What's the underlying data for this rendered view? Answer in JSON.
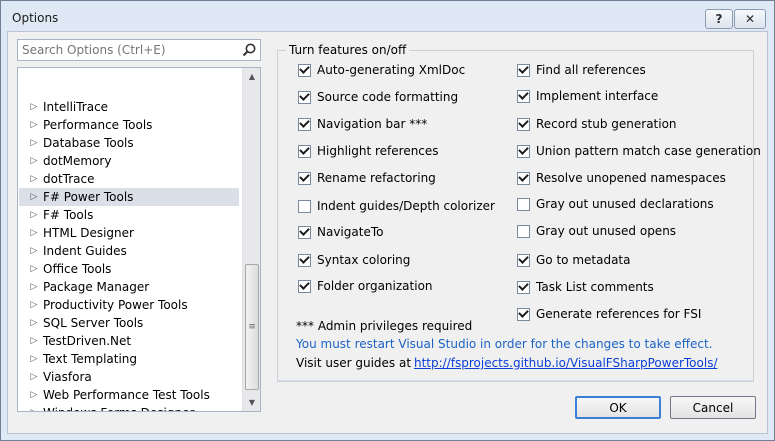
{
  "window": {
    "title": "Options",
    "help_label": "?",
    "close_label": "✕"
  },
  "search": {
    "placeholder": "Search Options (Ctrl+E)",
    "value": ""
  },
  "tree": {
    "items": [
      {
        "label": "IntelliTrace"
      },
      {
        "label": "Performance Tools"
      },
      {
        "label": "Database Tools"
      },
      {
        "label": "dotMemory"
      },
      {
        "label": "dotTrace"
      },
      {
        "label": "F# Power Tools",
        "selected": true
      },
      {
        "label": "F# Tools"
      },
      {
        "label": "HTML Designer"
      },
      {
        "label": "Indent Guides"
      },
      {
        "label": "Office Tools"
      },
      {
        "label": "Package Manager"
      },
      {
        "label": "Productivity Power Tools"
      },
      {
        "label": "SQL Server Tools"
      },
      {
        "label": "TestDriven.Net"
      },
      {
        "label": "Text Templating"
      },
      {
        "label": "Viasfora"
      },
      {
        "label": "Web Performance Test Tools"
      },
      {
        "label": "Windows Forms Designer"
      }
    ]
  },
  "features": {
    "group_label": "Turn features on/off",
    "left": [
      {
        "label": "Auto-generating XmlDoc",
        "checked": true
      },
      {
        "label": "Source code formatting",
        "checked": true
      },
      {
        "label": "Navigation bar ***",
        "checked": true
      },
      {
        "label": "Highlight references",
        "checked": true
      },
      {
        "label": "Rename refactoring",
        "checked": true
      },
      {
        "label": "Indent guides/Depth colorizer",
        "checked": false
      },
      {
        "label": "NavigateTo",
        "checked": true
      },
      {
        "label": "Syntax coloring",
        "checked": true
      },
      {
        "label": "Folder organization",
        "checked": true
      }
    ],
    "right": [
      {
        "label": "Find all references",
        "checked": true
      },
      {
        "label": "Implement interface",
        "checked": true
      },
      {
        "label": "Record stub generation",
        "checked": true
      },
      {
        "label": "Union pattern match case generation",
        "checked": true
      },
      {
        "label": "Resolve unopened namespaces",
        "checked": true
      },
      {
        "label": "Gray out unused declarations",
        "checked": false
      },
      {
        "label": "Gray out unused opens",
        "checked": false
      },
      {
        "label": "Go to metadata",
        "checked": true
      },
      {
        "label": "Task List comments",
        "checked": true
      },
      {
        "label": "Generate references for FSI",
        "checked": true
      }
    ],
    "admin_note": "*** Admin privileges required",
    "restart_note": "You must restart Visual Studio in order for the changes to take effect.",
    "guides_label": "Visit user guides at",
    "guides_link": "http://fsprojects.github.io/VisualFSharpPowerTools/"
  },
  "buttons": {
    "ok_label": "OK",
    "cancel_label": "Cancel"
  },
  "colors": {
    "accent": "#3c7fd6",
    "link": "#0b3fd6",
    "notice": "#1c63c4",
    "selection": "#dadfe8"
  }
}
